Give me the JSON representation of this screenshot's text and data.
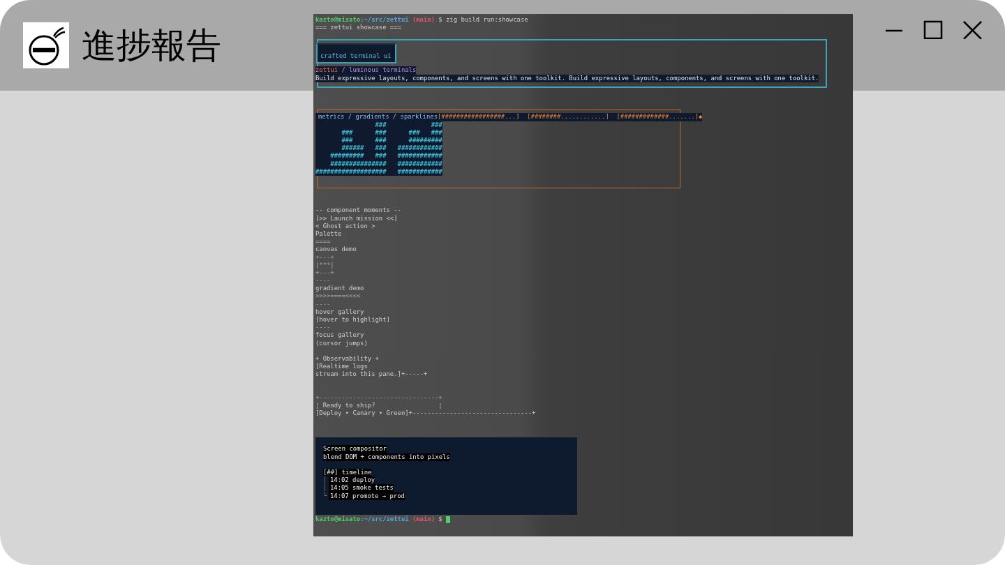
{
  "window": {
    "title": "進捗報告"
  },
  "terminal": {
    "command_prompt": [
      {
        "text": "kazto@misato",
        "kind": "user"
      },
      {
        "text": ":~/src/zettui",
        "kind": "path"
      },
      {
        "text": " (main)",
        "kind": "branch"
      },
      {
        "text": " $ zig build run:showcase",
        "kind": "plain"
      }
    ],
    "banner": "=== zettui showcase ===",
    "hero": {
      "badge": "crafted terminal ui",
      "title": [
        {
          "text": "zettui",
          "kind": "brand"
        },
        {
          "text": " / luminous terminals",
          "kind": "accent"
        }
      ],
      "tagline": "Build expressive layouts, components, and screens with one toolkit. Build expressive layouts, components, and screens with one toolkit."
    },
    "metrics": {
      "header": [
        {
          "text": "metrics / gradients / sparklines",
          "kind": "label"
        },
        {
          "text": "[#################...]  [########............]  [#############.......]",
          "kind": "bar"
        },
        {
          "text": "◆",
          "kind": "bar"
        }
      ],
      "art": [
        "                ###            ###",
        "       ###      ###      ###   ###",
        "       ###      ###      #########",
        "       ######   ###   ############",
        "    #########   ###   ############",
        "    ###############   ############",
        "###################   ############"
      ]
    },
    "component_lines": [
      {
        "kind": "text",
        "text": "-- component moments --"
      },
      {
        "kind": "text",
        "text": "[>> Launch mission <<]"
      },
      {
        "kind": "text",
        "text": "< Ghost action >"
      },
      {
        "kind": "text",
        "text": "Palette"
      },
      {
        "kind": "rule",
        "text": "===="
      },
      {
        "kind": "text",
        "text": "canvas demo"
      },
      {
        "kind": "rule",
        "text": "+---+"
      },
      {
        "kind": "rule",
        "text": "|***|"
      },
      {
        "kind": "rule",
        "text": "+---+"
      },
      {
        "kind": "rule",
        "text": "----"
      },
      {
        "kind": "text",
        "text": "gradient demo"
      },
      {
        "kind": "rule",
        "text": ">>>>====<<<<"
      },
      {
        "kind": "rule",
        "text": "----"
      },
      {
        "kind": "text",
        "text": "hover gallery"
      },
      {
        "kind": "text",
        "text": "[hover to highlight]"
      },
      {
        "kind": "rule",
        "text": "----"
      },
      {
        "kind": "text",
        "text": "focus gallery"
      },
      {
        "kind": "text",
        "text": "(cursor jumps)"
      },
      {
        "kind": "blank"
      },
      {
        "kind": "text",
        "text": "+ Observability +"
      },
      {
        "kind": "text",
        "text": "[Realtime logs"
      },
      {
        "kind": "text",
        "text": "stream into this pane.]+-----+"
      },
      {
        "kind": "blank"
      },
      {
        "kind": "blank"
      },
      {
        "kind": "rule",
        "text": "+--------------------------------+"
      },
      {
        "kind": "text",
        "text": "¦ Ready to ship?                 ¦"
      },
      {
        "kind": "text",
        "text": "[Deploy • Canary • Green]+--------------------------------+"
      }
    ],
    "compositor": {
      "title": "Screen compositor",
      "subtitle": "blend DOM + components into pixels",
      "timeline_heading": "[##] timeline",
      "events": [
        {
          "prefix": "│",
          "text": "14:02 deploy"
        },
        {
          "prefix": "│",
          "text": "14:05 smoke tests"
        },
        {
          "prefix": "└",
          "text": "14:07 promote → prod"
        }
      ]
    },
    "final_prompt": {
      "segments": [
        {
          "text": "kazto@misato",
          "kind": "user"
        },
        {
          "text": ":~/src/zettui",
          "kind": "path"
        },
        {
          "text": " (main)",
          "kind": "branch"
        },
        {
          "text": " $",
          "kind": "plain"
        }
      ],
      "cursor": true
    }
  }
}
